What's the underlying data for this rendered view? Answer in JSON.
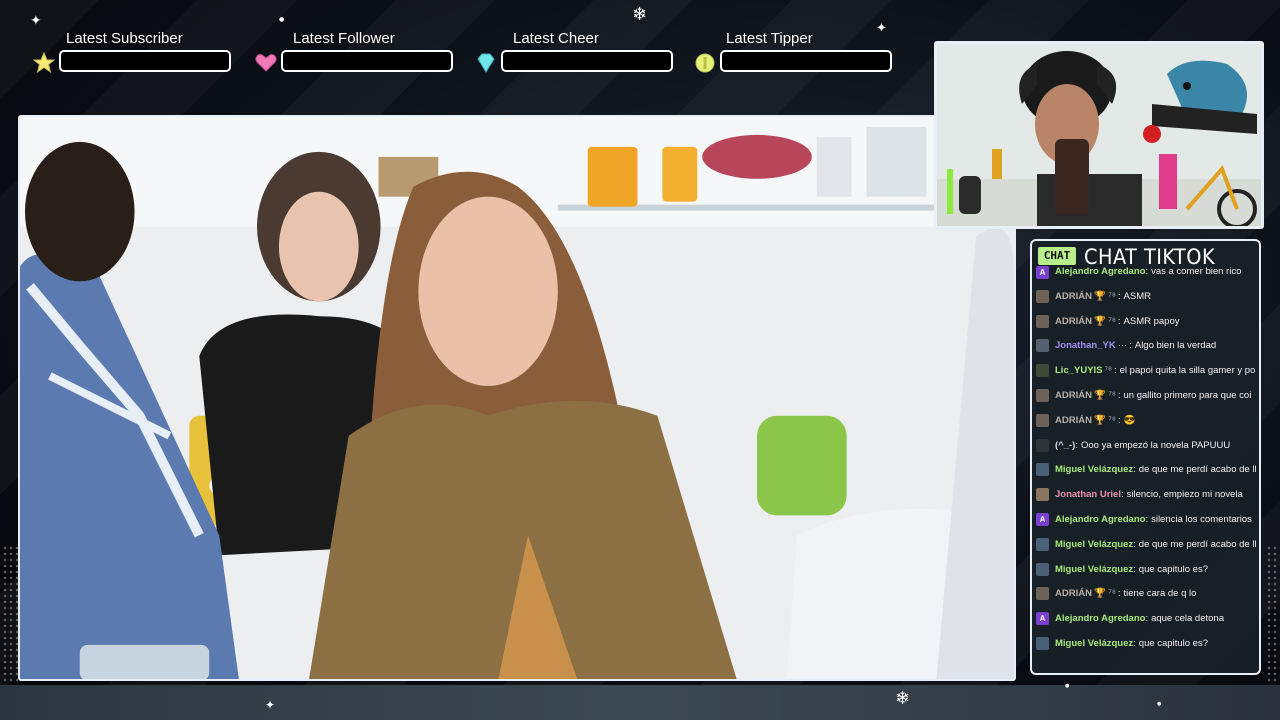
{
  "alerts": [
    {
      "label": "Latest Subscriber",
      "icon": "star-icon",
      "color": "#f4ea7a"
    },
    {
      "label": "Latest Follower",
      "icon": "heart-icon",
      "color": "#f07ab8"
    },
    {
      "label": "Latest Cheer",
      "icon": "gem-icon",
      "color": "#6fe6ea"
    },
    {
      "label": "Latest Tipper",
      "icon": "coin-icon",
      "color": "#e6f07a"
    }
  ],
  "chat": {
    "badge": "CHAT",
    "title": "CHAT TIKTOK",
    "messages": [
      {
        "user": "Alejandro Agredano",
        "sep": ":",
        "badges": "",
        "text": "vas a comer bien rico",
        "avatar_color": "#7a3fd0",
        "avatar_letter": "A",
        "name_color": "#a8e87a"
      },
      {
        "user": "ADRIÁN",
        "sep": ":",
        "badges": "🏆 ⁷⁸",
        "text": "ASMR",
        "avatar_color": "#6e6258",
        "avatar_letter": "",
        "name_color": "#b8b0a8"
      },
      {
        "user": "ADRIÁN",
        "sep": ":",
        "badges": "🏆 ⁷⁸",
        "text": "ASMR papoy",
        "avatar_color": "#6e6258",
        "avatar_letter": "",
        "name_color": "#b8b0a8"
      },
      {
        "user": "Jonathan_YK",
        "sep": ":",
        "badges": "···",
        "text": "Algo bien la verdad",
        "avatar_color": "#556070",
        "avatar_letter": "",
        "name_color": "#a090f0"
      },
      {
        "user": "Lic_YUYIS",
        "sep": ":",
        "badges": "⁷⁸",
        "text": "el papoi quita la silla gamer y po",
        "avatar_color": "#3e4a38",
        "avatar_letter": "",
        "name_color": "#a8e87a"
      },
      {
        "user": "ADRIÁN",
        "sep": ":",
        "badges": "🏆 ⁷⁸",
        "text": "un gallito primero para que coi",
        "avatar_color": "#6e6258",
        "avatar_letter": "",
        "name_color": "#b8b0a8"
      },
      {
        "user": "ADRIÁN",
        "sep": ":",
        "badges": "🏆 ⁷⁸",
        "text": "😎",
        "avatar_color": "#6e6258",
        "avatar_letter": "",
        "name_color": "#b8b0a8"
      },
      {
        "user": "(^_-)",
        "sep": ":",
        "badges": "",
        "text": "Ooo ya empezó la novela PAPUUU",
        "avatar_color": "#2e3438",
        "avatar_letter": "",
        "name_color": "#dddddd"
      },
      {
        "user": "Miguel Velázquez",
        "sep": ":",
        "badges": "",
        "text": "de que me perdí acabo de ll",
        "avatar_color": "#4a6078",
        "avatar_letter": "",
        "name_color": "#a8e87a"
      },
      {
        "user": "Jonathan Uriel",
        "sep": ":",
        "badges": "",
        "text": "silencio, empiezo mi novela",
        "avatar_color": "#8a7660",
        "avatar_letter": "",
        "name_color": "#f090b0"
      },
      {
        "user": "Alejandro Agredano",
        "sep": ":",
        "badges": "",
        "text": "silencia los comentarios",
        "avatar_color": "#7a3fd0",
        "avatar_letter": "A",
        "name_color": "#a8e87a"
      },
      {
        "user": "Miguel Velázquez",
        "sep": ":",
        "badges": "",
        "text": "de que me perdí acabo de ll",
        "avatar_color": "#4a6078",
        "avatar_letter": "",
        "name_color": "#a8e87a"
      },
      {
        "user": "Miguel Velázquez",
        "sep": ":",
        "badges": "",
        "text": "que capitulo es?",
        "avatar_color": "#4a6078",
        "avatar_letter": "",
        "name_color": "#a8e87a"
      },
      {
        "user": "ADRIÁN",
        "sep": ":",
        "badges": "🏆 ⁷⁸",
        "text": "tiene cara de q lo",
        "avatar_color": "#6e6258",
        "avatar_letter": "",
        "name_color": "#b8b0a8"
      },
      {
        "user": "Alejandro Agredano",
        "sep": ":",
        "badges": "",
        "text": "aque cela detona",
        "avatar_color": "#7a3fd0",
        "avatar_letter": "A",
        "name_color": "#a8e87a"
      },
      {
        "user": "Miguel Velázquez",
        "sep": ":",
        "badges": "",
        "text": "que capitulo es?",
        "avatar_color": "#4a6078",
        "avatar_letter": "",
        "name_color": "#a8e87a"
      }
    ]
  },
  "colors": {
    "frame_border": "#e8eef5",
    "chat_badge": "#b6ef8c",
    "panel_bg": "#182028"
  }
}
